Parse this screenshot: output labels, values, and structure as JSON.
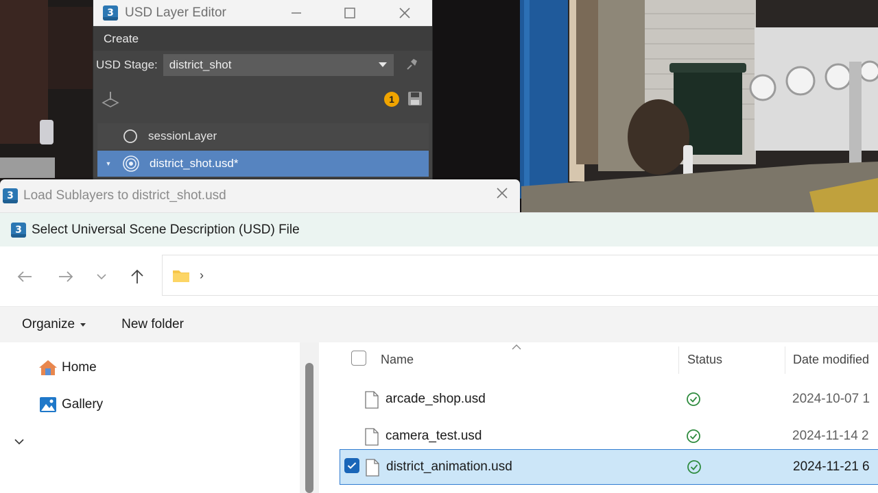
{
  "usd_layer_editor": {
    "title": "USD Layer Editor",
    "menu": [
      "Create"
    ],
    "stage_label": "USD Stage:",
    "stage_value": "district_shot",
    "badge_count": "1",
    "layers": [
      {
        "name": "sessionLayer",
        "icon": "session-layer-icon",
        "selected": false
      },
      {
        "name": "district_shot.usd*",
        "icon": "root-layer-icon",
        "selected": true
      }
    ]
  },
  "load_dialog": {
    "title": "Load Sublayers to district_shot.usd"
  },
  "file_dialog": {
    "title": "Select Universal Scene Description (USD) File",
    "toolbar": {
      "organize_label": "Organize",
      "new_folder_label": "New folder"
    },
    "nav_pane": {
      "items": [
        {
          "label": "Home",
          "icon": "home-icon"
        },
        {
          "label": "Gallery",
          "icon": "gallery-icon"
        }
      ]
    },
    "columns": [
      "Name",
      "Status",
      "Date modified"
    ],
    "files": [
      {
        "name": "arcade_shop.usd",
        "date": "2024-10-07 1",
        "status": "synced",
        "checked": false
      },
      {
        "name": "camera_test.usd",
        "date": "2024-11-14 2",
        "status": "synced",
        "checked": false
      },
      {
        "name": "district_animation.usd",
        "date": "2024-11-21 6",
        "status": "synced",
        "checked": true
      }
    ]
  },
  "colors": {
    "selection_blue": "#5684c0",
    "list_selection": "#cce6f8",
    "status_green": "#2e8b3e",
    "badge_orange": "#f0a400",
    "app_icon_blue": "#2b77b3"
  }
}
